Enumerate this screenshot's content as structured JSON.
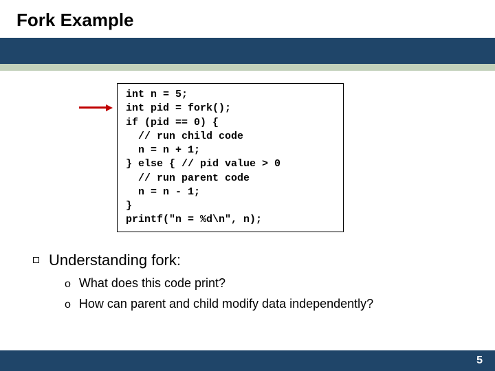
{
  "title": "Fork Example",
  "code_lines": [
    "int n = 5;",
    "int pid = fork();",
    "if (pid == 0) {",
    "  // run child code",
    "  n = n + 1;",
    "} else { // pid value > 0",
    "  // run parent code",
    "  n = n - 1;",
    "}",
    "printf(\"n = %d\\n\", n);"
  ],
  "bullets": {
    "lvl1_text": "Understanding fork:",
    "lvl2": [
      "What does this code print?",
      "How can parent and child modify data independently?"
    ]
  },
  "lvl2_marker": "o",
  "page_number": "5"
}
